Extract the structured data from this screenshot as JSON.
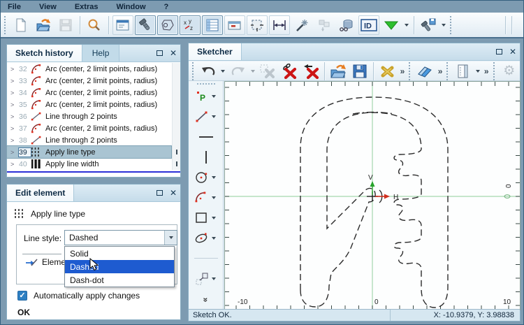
{
  "window": {
    "menu_items": [
      "File",
      "View",
      "Extras",
      "Window",
      "?"
    ]
  },
  "main_toolbar": {
    "id_label": "ID",
    "xyz_label": "xyz",
    "overflow_glyph": "»"
  },
  "history_panel": {
    "title": "Sketch history",
    "help_tab": "Help",
    "rows": [
      {
        "num": "32",
        "icon": "arc",
        "label": "Arc (center, 2 limit points, radius)",
        "selected": false
      },
      {
        "num": "33",
        "icon": "arc",
        "label": "Arc (center, 2 limit points, radius)",
        "selected": false
      },
      {
        "num": "34",
        "icon": "arc",
        "label": "Arc (center, 2 limit points, radius)",
        "selected": false
      },
      {
        "num": "35",
        "icon": "arc",
        "label": "Arc (center, 2 limit points, radius)",
        "selected": false
      },
      {
        "num": "36",
        "icon": "line",
        "label": "Line through 2 points",
        "selected": false
      },
      {
        "num": "37",
        "icon": "arc",
        "label": "Arc (center, 2 limit points, radius)",
        "selected": false
      },
      {
        "num": "38",
        "icon": "line",
        "label": "Line through 2 points",
        "selected": false
      },
      {
        "num": "39",
        "icon": "linetype",
        "label": "Apply line type",
        "selected": true
      },
      {
        "num": "40",
        "icon": "linewidth",
        "label": "Apply line width",
        "selected": false
      }
    ]
  },
  "edit_panel": {
    "title": "Edit element",
    "tool_label": "Apply line type",
    "line_style_label": "Line style:",
    "line_style_value": "Dashed",
    "options": [
      "Solid",
      "Dashed",
      "Dash-dot"
    ],
    "highlighted_option": "Dashed",
    "elements_label": "Eleme",
    "auto_apply_label": "Automatically apply changes",
    "ok_label": "OK"
  },
  "sketcher": {
    "title": "Sketcher",
    "status_left": "Sketch OK.",
    "status_right": "X: -10.9379, Y: 3.98838",
    "point_tool_label": "P",
    "canvas": {
      "x_min_label": "-10",
      "x_zero_label": "0",
      "x_max_label": "10",
      "y_zero_label": "0",
      "v_axis_label": "V",
      "h_axis_label": "H"
    }
  },
  "colors": {
    "accent_blue": "#1e5bd0",
    "checkbox_blue": "#2e7fc2",
    "axis_green": "#a6d7ae",
    "arrow_red": "#d03020",
    "arrow_green": "#27a32b",
    "insert_line_blue": "#2b2fd6",
    "selected_row": "#a9c4d2",
    "workspace_steel": "#7d9bb1"
  }
}
